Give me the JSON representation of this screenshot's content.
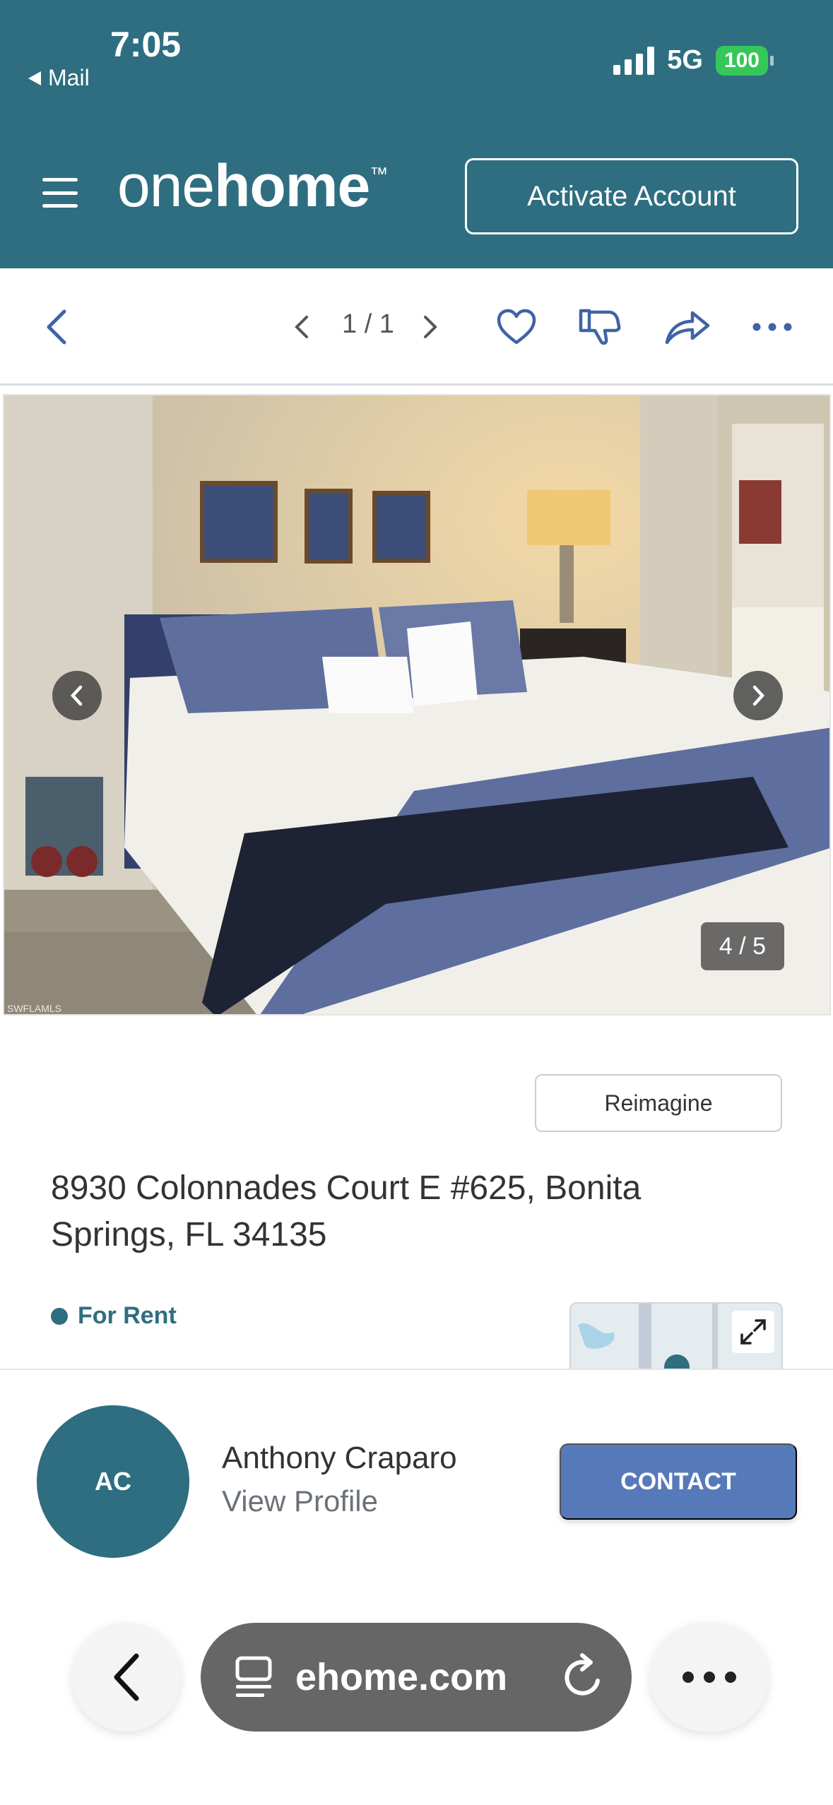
{
  "status_bar": {
    "time": "7:05",
    "back_app": "Mail",
    "network": "5G",
    "battery": "100"
  },
  "header": {
    "logo_light": "one",
    "logo_bold": "home",
    "logo_tm": "™",
    "activate_label": "Activate Account"
  },
  "toolbar": {
    "pager": "1 / 1"
  },
  "photo": {
    "counter": "4 / 5",
    "watermark": "SWFLAMLS"
  },
  "listing": {
    "reimagine_label": "Reimagine",
    "address": "8930 Colonnades Court E #625,  Bonita Springs, FL 34135",
    "status": "For Rent"
  },
  "agent": {
    "initials": "AC",
    "name": "Anthony Craparo",
    "view_profile": "View Profile",
    "contact_label": "CONTACT"
  },
  "browser": {
    "url": "ehome.com"
  },
  "colors": {
    "brand_teal": "#2e6e80",
    "contact_blue": "#5679b9",
    "battery_green": "#36c759"
  }
}
